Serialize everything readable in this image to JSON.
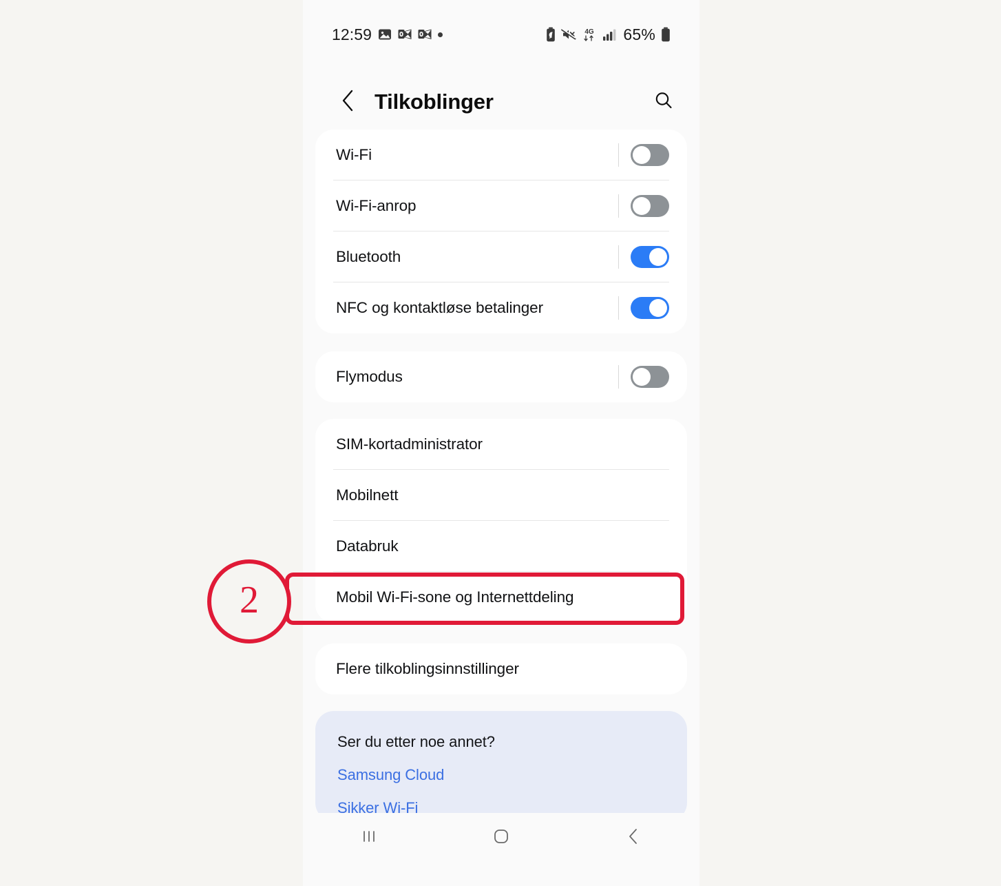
{
  "status_bar": {
    "time": "12:59",
    "battery_percent": "65%",
    "left_icons": [
      "gallery-icon",
      "outlook-mail-icon",
      "outlook-mail-icon",
      "dot-icon"
    ],
    "right_icons": [
      "power-saving-icon",
      "mute-icon",
      "4g-data-icon",
      "signal-bars-icon",
      "battery-icon"
    ],
    "network_label": "4G"
  },
  "app_bar": {
    "title": "Tilkoblinger",
    "back_icon": "chevron-left-icon",
    "search_icon": "search-icon"
  },
  "cards": {
    "toggles": [
      {
        "label": "Wi-Fi",
        "state": "off"
      },
      {
        "label": "Wi-Fi-anrop",
        "state": "off"
      },
      {
        "label": "Bluetooth",
        "state": "on"
      },
      {
        "label": "NFC og kontaktløse betalinger",
        "state": "on"
      }
    ],
    "airplane": [
      {
        "label": "Flymodus",
        "state": "off"
      }
    ],
    "network_items": [
      {
        "label": "SIM-kortadministrator"
      },
      {
        "label": "Mobilnett"
      },
      {
        "label": "Databruk"
      },
      {
        "label": "Mobil Wi-Fi-sone og Internettdeling"
      }
    ],
    "more": [
      {
        "label": "Flere tilkoblingsinnstillinger"
      }
    ],
    "help": {
      "title": "Ser du etter noe annet?",
      "links": [
        "Samsung Cloud",
        "Sikker Wi-Fi"
      ]
    }
  },
  "nav_bar": {
    "recents_icon": "recents-icon",
    "home_icon": "home-icon",
    "back_icon": "back-icon"
  },
  "annotation": {
    "step_number": "2",
    "color": "#e01a37",
    "highlights_label": "Mobil Wi-Fi-sone og Internettdeling"
  },
  "colors": {
    "page_background": "#f6f5f2",
    "screen_background": "#fafafa",
    "card": "#ffffff",
    "card_tinted": "#e7ebf7",
    "toggle_on": "#2b7cf6",
    "toggle_off": "#8d9296",
    "link": "#3b6fe2"
  }
}
